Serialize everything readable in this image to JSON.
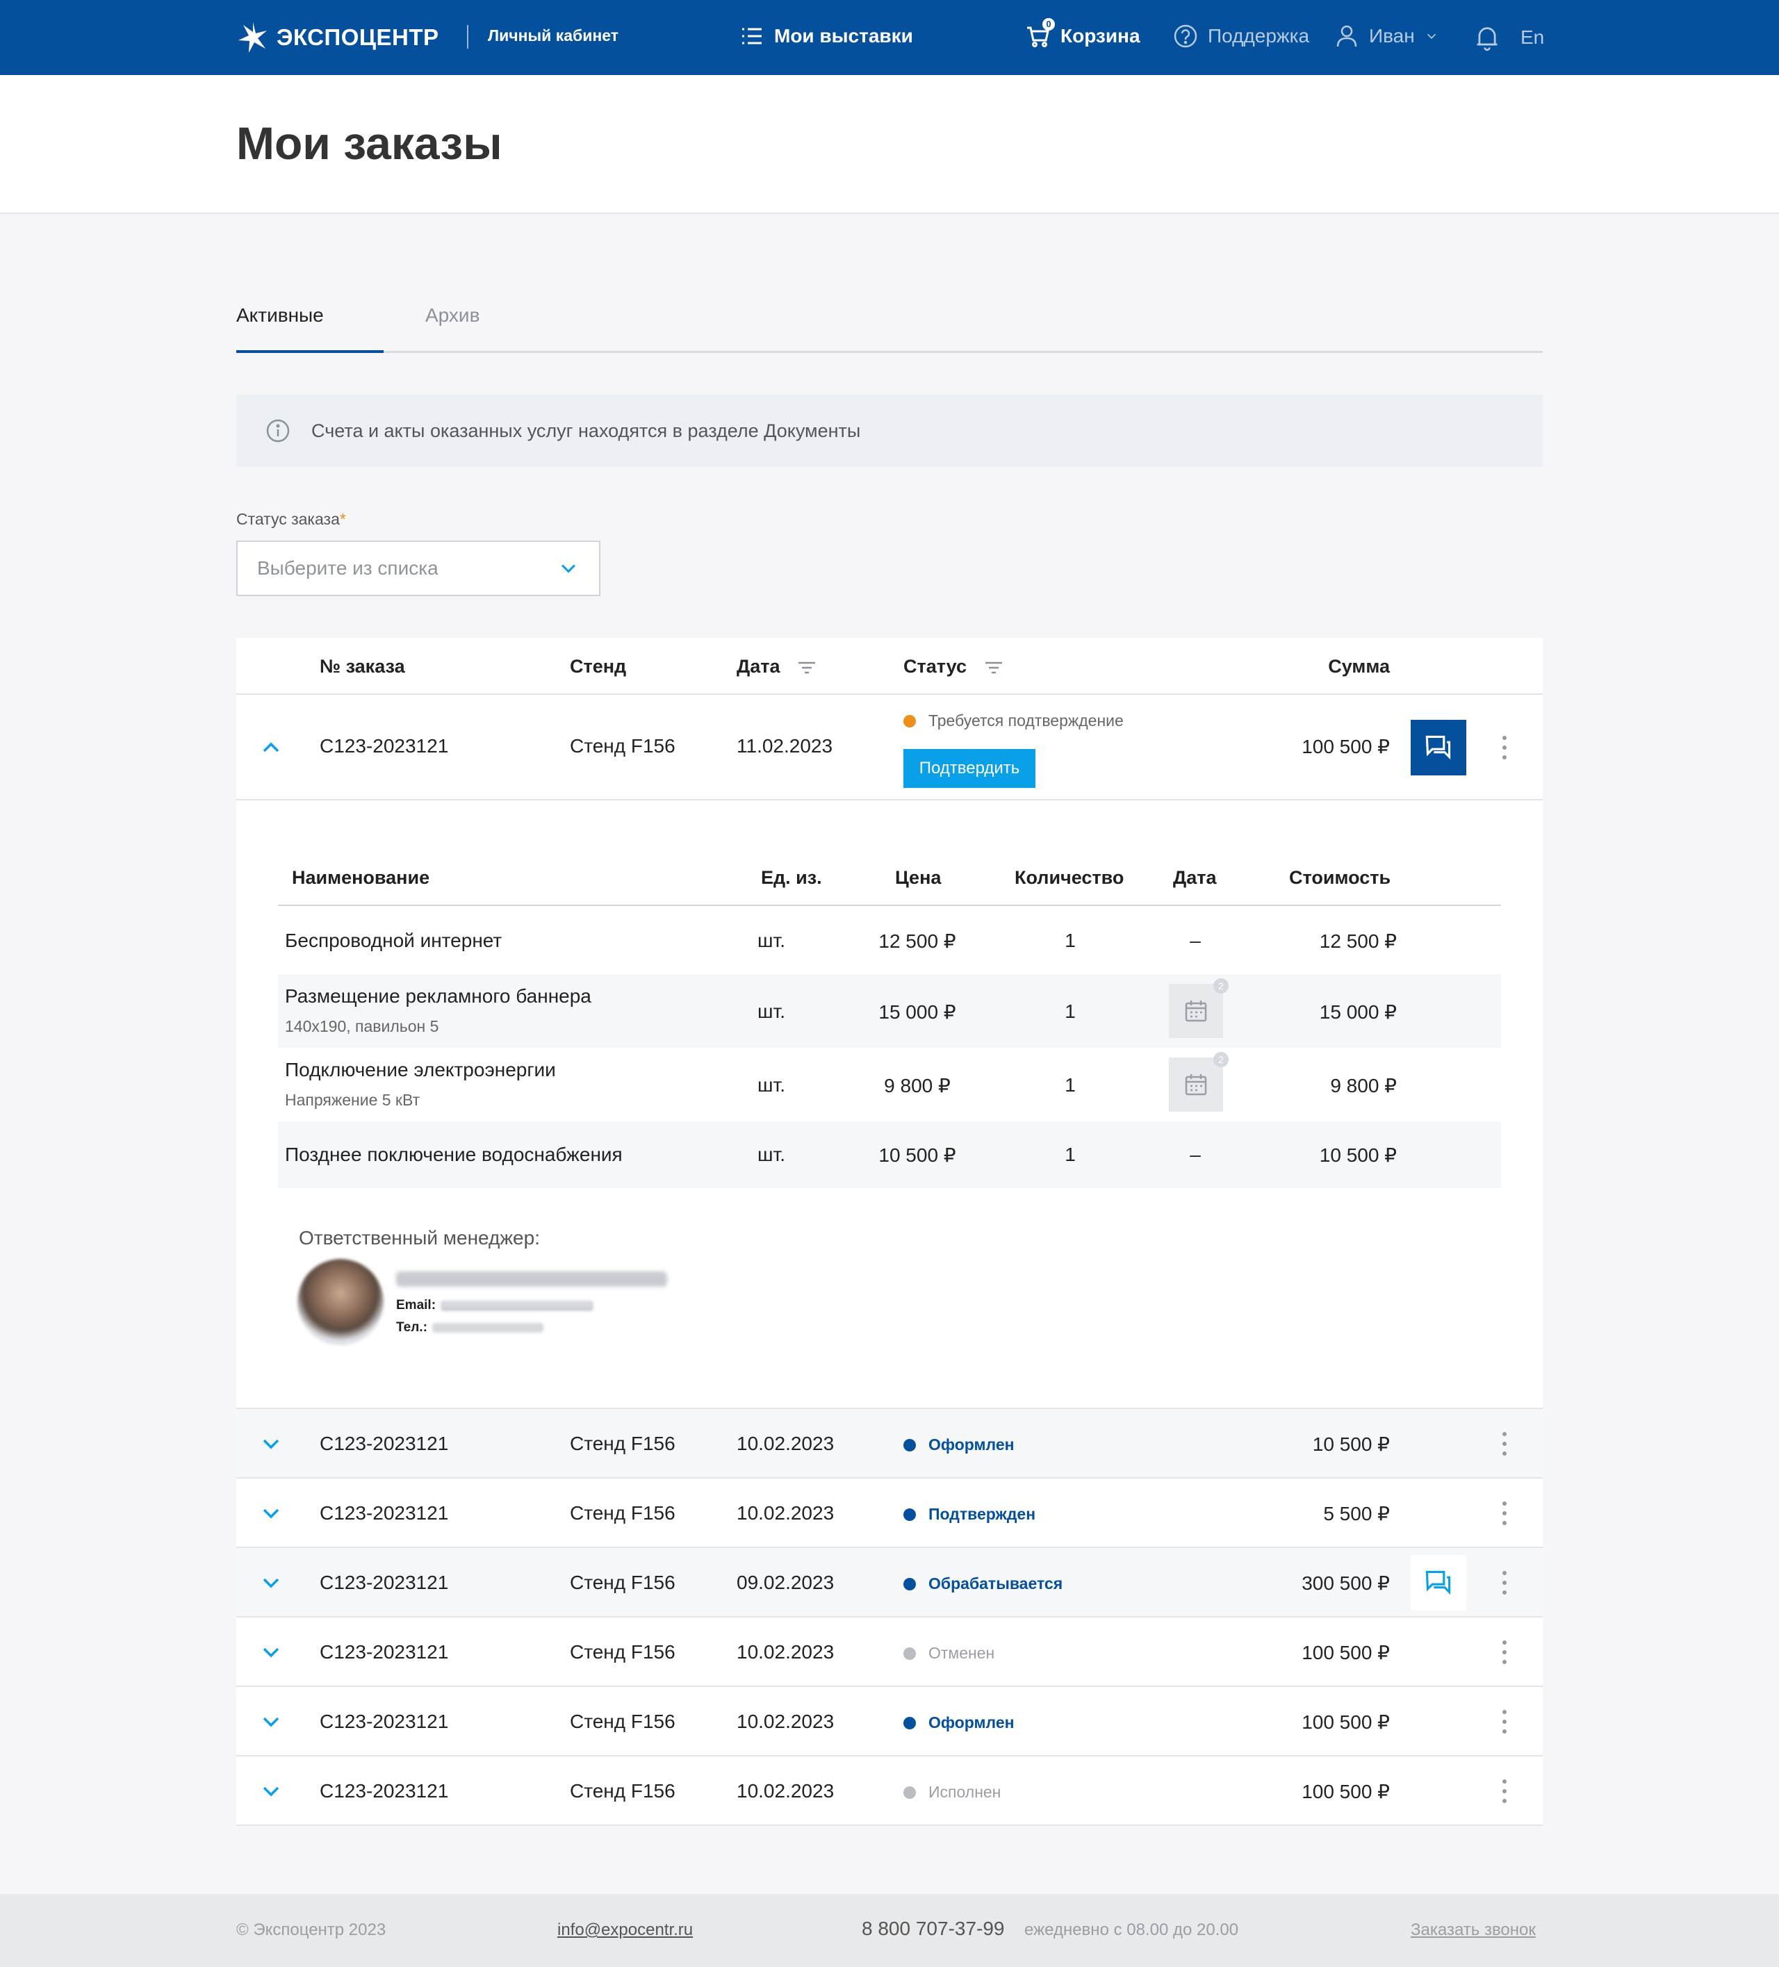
{
  "header": {
    "logo_text": "ЭКСПОЦЕНТР",
    "cabinet": "Личный кабинет",
    "my_exhibitions": "Мои выставки",
    "cart": "Корзина",
    "cart_count": "0",
    "support": "Поддержка",
    "user": "Иван",
    "lang": "En"
  },
  "page": {
    "title": "Мои заказы"
  },
  "tabs": [
    {
      "label": "Активные",
      "active": true
    },
    {
      "label": "Архив",
      "active": false
    }
  ],
  "info": {
    "text": "Счета и акты оказанных услуг находятся в разделе Документы"
  },
  "filter": {
    "label": "Статус заказа",
    "required_mark": "*",
    "placeholder": "Выберите из списка"
  },
  "table": {
    "headers": {
      "number": "№ заказа",
      "stand": "Стенд",
      "date": "Дата",
      "status": "Статус",
      "sum": "Сумма"
    },
    "expanded_order": {
      "number": "C123-2023121",
      "stand": "Стенд F156",
      "date": "11.02.2023",
      "status": "Требуется подтверждение",
      "confirm_label": "Подтвердить",
      "sum": "100 500 ₽",
      "items_headers": {
        "name": "Наименование",
        "unit": "Ед. из.",
        "price": "Цена",
        "qty": "Количество",
        "date": "Дата",
        "cost": "Стоимость"
      },
      "items": [
        {
          "name": "Беспроводной интернет",
          "sub": "",
          "unit": "шт.",
          "price": "12 500 ₽",
          "qty": "1",
          "date": "–",
          "cost": "12 500 ₽"
        },
        {
          "name": "Размещение рекламного баннера",
          "sub": "140x190, павильон 5",
          "unit": "шт.",
          "price": "15 000 ₽",
          "qty": "1",
          "date_badge": "2",
          "cost": "15 000 ₽"
        },
        {
          "name": "Подключение электроэнергии",
          "sub": "Напряжение 5 кВт",
          "unit": "шт.",
          "price": "9 800 ₽",
          "qty": "1",
          "date_badge": "2",
          "cost": "9 800 ₽"
        },
        {
          "name": "Позднее поключение водоснабжения",
          "sub": "",
          "unit": "шт.",
          "price": "10 500 ₽",
          "qty": "1",
          "date": "–",
          "cost": "10 500 ₽"
        }
      ],
      "manager_label": "Ответственный менеджер:",
      "email_label": "Email:",
      "tel_label": "Тел.:"
    },
    "rows": [
      {
        "number": "C123-2023121",
        "stand": "Стенд F156",
        "date": "10.02.2023",
        "status": "Оформлен",
        "sum": "10 500 ₽"
      },
      {
        "number": "C123-2023121",
        "stand": "Стенд F156",
        "date": "10.02.2023",
        "status": "Подтвержден",
        "sum": "5 500 ₽"
      },
      {
        "number": "C123-2023121",
        "stand": "Стенд F156",
        "date": "09.02.2023",
        "status": "Обрабатывается",
        "sum": "300 500 ₽"
      },
      {
        "number": "C123-2023121",
        "stand": "Стенд F156",
        "date": "10.02.2023",
        "status": "Отменен",
        "sum": "100 500 ₽"
      },
      {
        "number": "C123-2023121",
        "stand": "Стенд F156",
        "date": "10.02.2023",
        "status": "Оформлен",
        "sum": "100 500 ₽"
      },
      {
        "number": "C123-2023121",
        "stand": "Стенд F156",
        "date": "10.02.2023",
        "status": "Исполнен",
        "sum": "100 500 ₽"
      }
    ]
  },
  "footer": {
    "copyright": "© Экспоцентр 2023",
    "email": "info@expocentr.ru",
    "phone": "8 800 707-37-99",
    "hours": "ежедневно с 08.00 до 20.00",
    "callback": "Заказать звонок"
  },
  "colors": {
    "brand": "#05509c",
    "accent": "#0aa0e8",
    "warning": "#ef8f1b",
    "muted": "#b9bcc1"
  }
}
